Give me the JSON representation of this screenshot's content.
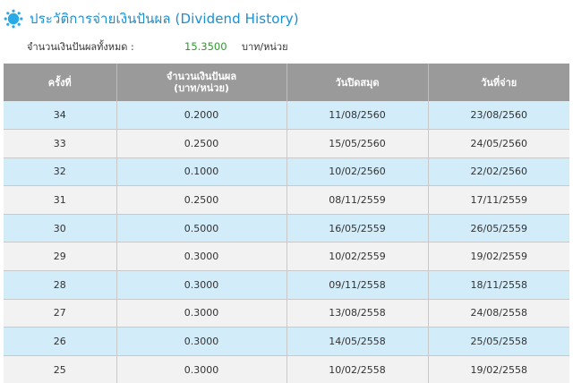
{
  "title": "ประวัติการจ่ายเงินปันผล (Dividend History)",
  "summary": {
    "label": "จำนวนเงินปันผลทั้งหมด :",
    "value": "15.3500",
    "unit": "บาท/หน่วย"
  },
  "colors": {
    "title": "#1a8fd1",
    "value": "#2e9a2e",
    "header_bg": "#9a9a9a",
    "row_blue": "#d2ecfa",
    "row_gray": "#f2f2f2"
  },
  "icons": {
    "title_icon": "sun-icon"
  },
  "table": {
    "headers": [
      "ครั้งที่",
      "จำนวนเงินปันผล\n(บาท/หน่วย)",
      "วันปิดสมุด",
      "วันที่จ่าย"
    ],
    "rows": [
      [
        "34",
        "0.2000",
        "11/08/2560",
        "23/08/2560"
      ],
      [
        "33",
        "0.2500",
        "15/05/2560",
        "24/05/2560"
      ],
      [
        "32",
        "0.1000",
        "10/02/2560",
        "22/02/2560"
      ],
      [
        "31",
        "0.2500",
        "08/11/2559",
        "17/11/2559"
      ],
      [
        "30",
        "0.5000",
        "16/05/2559",
        "26/05/2559"
      ],
      [
        "29",
        "0.3000",
        "10/02/2559",
        "19/02/2559"
      ],
      [
        "28",
        "0.3000",
        "09/11/2558",
        "18/11/2558"
      ],
      [
        "27",
        "0.3000",
        "13/08/2558",
        "24/08/2558"
      ],
      [
        "26",
        "0.3000",
        "14/05/2558",
        "25/05/2558"
      ],
      [
        "25",
        "0.3000",
        "10/02/2558",
        "19/02/2558"
      ]
    ]
  }
}
